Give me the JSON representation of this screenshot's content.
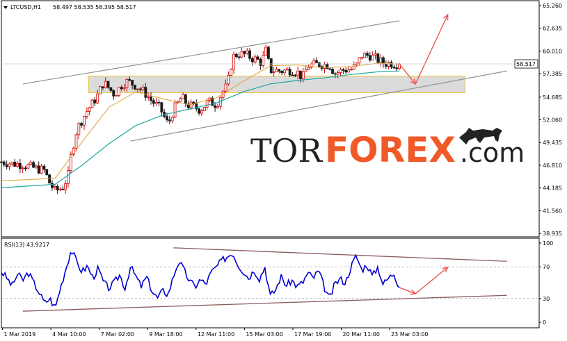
{
  "header": {
    "symbol_label": "LTCUSD,H1",
    "ohlc_label": "58.497 58.535 58.395 58.517"
  },
  "rsi_panel": {
    "label": "RSI(13) 43.9217"
  },
  "watermark": {
    "part1": "TOR",
    "part2": "FOREX",
    "part3": ".com"
  },
  "colors": {
    "bull": "#d40000",
    "bear": "#1a1a1a",
    "ma_fast": "#e0a030",
    "ma_slow": "#20a8a0",
    "rsi": "#0000d0",
    "trend_upper": "#999999",
    "trend_lower": "#8b5a5a",
    "arrow": "#ee5555",
    "zone_fill": "#cccccc",
    "zone_border": "#f0c030"
  },
  "chart_data": [
    {
      "type": "candlestick",
      "title": "LTCUSD,H1",
      "ylim": [
        38.935,
        65.26
      ],
      "y_ticks": [
        "65.260",
        "62.635",
        "60.010",
        "57.385",
        "54.685",
        "52.060",
        "49.435",
        "46.810",
        "44.185",
        "41.560",
        "38.935"
      ],
      "current_price": "58.517",
      "x_ticks": [
        "1 Mar 2019",
        "4 Mar 10:00",
        "7 Mar 02:00",
        "9 Mar 18:00",
        "12 Mar 11:00",
        "15 Mar 03:00",
        "17 Mar 19:00",
        "20 Mar 11:00",
        "23 Mar 03:00"
      ],
      "close_path": [
        [
          0,
          47.2
        ],
        [
          0.02,
          47.0
        ],
        [
          0.04,
          46.9
        ],
        [
          0.06,
          46.5
        ],
        [
          0.08,
          46.2
        ],
        [
          0.09,
          44.7
        ],
        [
          0.1,
          43.8
        ],
        [
          0.115,
          44.3
        ],
        [
          0.125,
          45.8
        ],
        [
          0.13,
          48.2
        ],
        [
          0.14,
          50.9
        ],
        [
          0.15,
          52.1
        ],
        [
          0.16,
          53.2
        ],
        [
          0.17,
          54.0
        ],
        [
          0.18,
          55.0
        ],
        [
          0.19,
          56.4
        ],
        [
          0.2,
          55.7
        ],
        [
          0.21,
          55.0
        ],
        [
          0.225,
          56.2
        ],
        [
          0.235,
          56.5
        ],
        [
          0.25,
          56.0
        ],
        [
          0.265,
          55.3
        ],
        [
          0.28,
          54.2
        ],
        [
          0.295,
          53.4
        ],
        [
          0.31,
          51.5
        ],
        [
          0.32,
          53.2
        ],
        [
          0.335,
          54.7
        ],
        [
          0.345,
          53.8
        ],
        [
          0.36,
          53.5
        ],
        [
          0.37,
          53.2
        ],
        [
          0.385,
          54.2
        ],
        [
          0.4,
          53.8
        ],
        [
          0.41,
          55.2
        ],
        [
          0.42,
          56.0
        ],
        [
          0.43,
          59.3
        ],
        [
          0.44,
          59.7
        ],
        [
          0.455,
          59.6
        ],
        [
          0.465,
          59.2
        ],
        [
          0.475,
          59.0
        ],
        [
          0.485,
          58.6
        ],
        [
          0.49,
          60.5
        ],
        [
          0.5,
          57.8
        ],
        [
          0.52,
          57.7
        ],
        [
          0.54,
          57.8
        ],
        [
          0.55,
          57.6
        ],
        [
          0.56,
          56.9
        ],
        [
          0.57,
          58.3
        ],
        [
          0.59,
          58.5
        ],
        [
          0.61,
          58.4
        ],
        [
          0.62,
          57.4
        ],
        [
          0.635,
          57.8
        ],
        [
          0.65,
          57.9
        ],
        [
          0.66,
          58.3
        ],
        [
          0.67,
          59.5
        ],
        [
          0.685,
          59.5
        ],
        [
          0.7,
          59.0
        ],
        [
          0.71,
          58.6
        ],
        [
          0.725,
          58.6
        ],
        [
          0.73,
          58.5
        ],
        [
          0.74,
          58.517
        ]
      ],
      "sma_fast": [
        [
          0.0,
          45.0
        ],
        [
          0.1,
          45.3
        ],
        [
          0.15,
          49.5
        ],
        [
          0.2,
          53.5
        ],
        [
          0.25,
          55.3
        ],
        [
          0.3,
          54.5
        ],
        [
          0.35,
          53.8
        ],
        [
          0.4,
          54.6
        ],
        [
          0.45,
          56.5
        ],
        [
          0.5,
          58.3
        ],
        [
          0.55,
          58.4
        ],
        [
          0.6,
          58.1
        ],
        [
          0.65,
          58.2
        ],
        [
          0.7,
          58.6
        ],
        [
          0.74,
          58.5
        ]
      ],
      "sma_slow": [
        [
          0.0,
          44.2
        ],
        [
          0.1,
          44.6
        ],
        [
          0.15,
          46.8
        ],
        [
          0.2,
          49.3
        ],
        [
          0.25,
          51.4
        ],
        [
          0.3,
          52.6
        ],
        [
          0.35,
          53.3
        ],
        [
          0.4,
          54.0
        ],
        [
          0.45,
          55.3
        ],
        [
          0.5,
          56.2
        ],
        [
          0.55,
          56.6
        ],
        [
          0.6,
          56.9
        ],
        [
          0.65,
          57.3
        ],
        [
          0.7,
          57.6
        ],
        [
          0.74,
          57.7
        ]
      ],
      "support_zone": [
        55.2,
        57.1
      ],
      "channel_upper": [
        [
          0.04,
          56.2
        ],
        [
          0.74,
          63.5
        ]
      ],
      "channel_lower": [
        [
          0.24,
          49.6
        ],
        [
          0.94,
          57.7
        ]
      ],
      "forecast_path": [
        [
          0.74,
          58.517
        ],
        [
          0.77,
          56.2
        ],
        [
          0.83,
          64.2
        ]
      ]
    },
    {
      "type": "line",
      "title": "RSI(13) 43.9217",
      "ylim": [
        0,
        100
      ],
      "y_ticks": [
        "100",
        "70",
        "30",
        "0"
      ],
      "value": "43.9217",
      "values": [
        [
          0,
          64
        ],
        [
          0.01,
          56
        ],
        [
          0.02,
          46
        ],
        [
          0.03,
          61
        ],
        [
          0.04,
          53
        ],
        [
          0.05,
          63
        ],
        [
          0.06,
          50
        ],
        [
          0.07,
          38
        ],
        [
          0.08,
          24
        ],
        [
          0.09,
          30
        ],
        [
          0.1,
          18
        ],
        [
          0.11,
          44
        ],
        [
          0.12,
          68
        ],
        [
          0.13,
          92
        ],
        [
          0.14,
          76
        ],
        [
          0.15,
          64
        ],
        [
          0.16,
          71
        ],
        [
          0.17,
          56
        ],
        [
          0.18,
          68
        ],
        [
          0.19,
          50
        ],
        [
          0.2,
          43
        ],
        [
          0.21,
          50
        ],
        [
          0.22,
          60
        ],
        [
          0.23,
          43
        ],
        [
          0.24,
          70
        ],
        [
          0.25,
          58
        ],
        [
          0.26,
          45
        ],
        [
          0.27,
          57
        ],
        [
          0.28,
          40
        ],
        [
          0.29,
          30
        ],
        [
          0.3,
          40
        ],
        [
          0.31,
          35
        ],
        [
          0.32,
          58
        ],
        [
          0.33,
          78
        ],
        [
          0.34,
          65
        ],
        [
          0.35,
          52
        ],
        [
          0.36,
          45
        ],
        [
          0.37,
          54
        ],
        [
          0.38,
          48
        ],
        [
          0.39,
          63
        ],
        [
          0.4,
          70
        ],
        [
          0.41,
          78
        ],
        [
          0.42,
          83
        ],
        [
          0.43,
          88
        ],
        [
          0.44,
          73
        ],
        [
          0.45,
          64
        ],
        [
          0.46,
          56
        ],
        [
          0.47,
          66
        ],
        [
          0.48,
          55
        ],
        [
          0.49,
          70
        ],
        [
          0.5,
          33
        ],
        [
          0.51,
          41
        ],
        [
          0.52,
          58
        ],
        [
          0.53,
          46
        ],
        [
          0.54,
          53
        ],
        [
          0.55,
          45
        ],
        [
          0.56,
          50
        ],
        [
          0.57,
          62
        ],
        [
          0.58,
          56
        ],
        [
          0.59,
          65
        ],
        [
          0.6,
          45
        ],
        [
          0.61,
          29
        ],
        [
          0.62,
          48
        ],
        [
          0.63,
          55
        ],
        [
          0.64,
          50
        ],
        [
          0.65,
          70
        ],
        [
          0.66,
          84
        ],
        [
          0.67,
          66
        ],
        [
          0.68,
          73
        ],
        [
          0.69,
          58
        ],
        [
          0.7,
          70
        ],
        [
          0.71,
          48
        ],
        [
          0.72,
          56
        ],
        [
          0.73,
          62
        ],
        [
          0.74,
          43.9217
        ]
      ],
      "trend_upper": [
        [
          0.32,
          94
        ],
        [
          0.94,
          77
        ]
      ],
      "trend_lower": [
        [
          0.04,
          14
        ],
        [
          0.94,
          34
        ]
      ],
      "forecast_path": [
        [
          0.74,
          43.9
        ],
        [
          0.77,
          36.0
        ],
        [
          0.83,
          69.5
        ]
      ]
    }
  ]
}
